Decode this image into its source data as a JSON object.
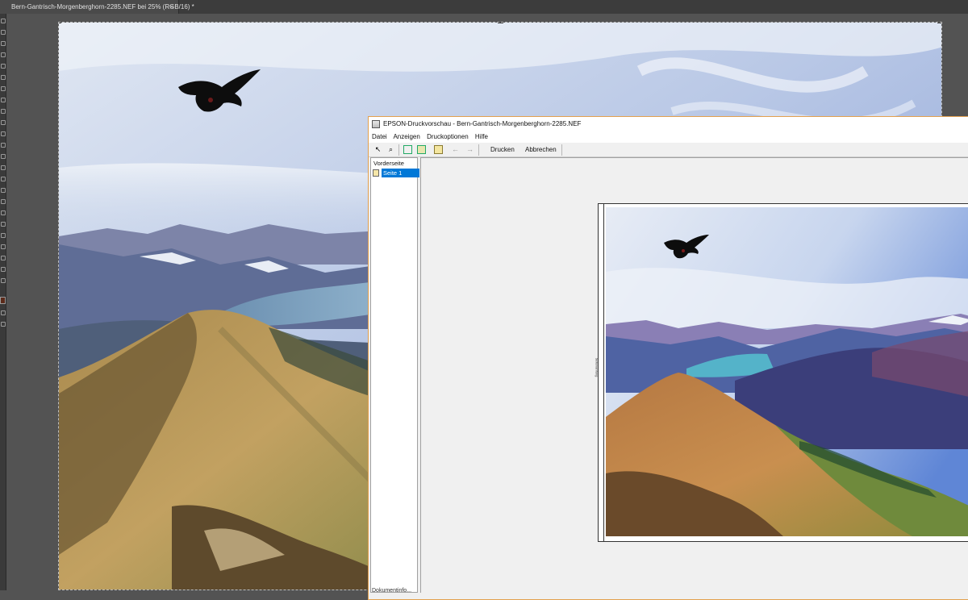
{
  "photoshop": {
    "document_tab": "Bern-Gantrisch-Morgenberghorn-2285.NEF bei 25% (RGB/16) *",
    "close_symbol": "×"
  },
  "epson": {
    "title": "EPSON-Druckvorschau - Bern-Gantrisch-Morgenberghorn-2285.NEF",
    "menu": [
      "Datei",
      "Anzeigen",
      "Druckoptionen",
      "Hilfe"
    ],
    "toolbar": {
      "print_label": "Drucken",
      "cancel_label": "Abbrechen"
    },
    "pagelist": {
      "header": "Vorderseite",
      "item": "Seite 1"
    },
    "paper_edge_label": "Seitenanfang",
    "status": "Dokumentinfo..."
  },
  "colors": {
    "accent_selection": "#0078d7",
    "window_border": "#e3a04e",
    "ps_background": "#535353"
  }
}
